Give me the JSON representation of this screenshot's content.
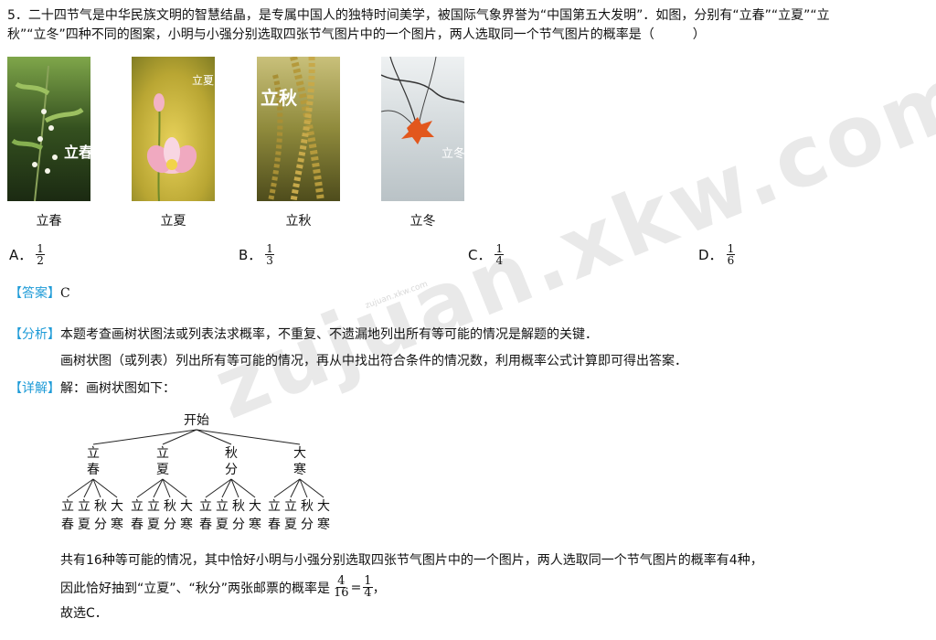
{
  "question": {
    "line1": "5．二十四节气是中华民族文明的智慧结晶，是专属中国人的独特时间美学，被国际气象界誉为“中国第五大发明”．如图，分别有“立春”“立夏”“立",
    "line2": "秋”“立冬”四种不同的图案，小明与小强分别选取四张节气图片中的一个图片，两人选取同一个节气图片的概率是（　　　）"
  },
  "images": [
    {
      "caption": "立春",
      "overlay": "立春"
    },
    {
      "caption": "立夏",
      "overlay": "立夏"
    },
    {
      "caption": "立秋",
      "overlay": "立秋"
    },
    {
      "caption": "立冬",
      "overlay": "立冬"
    }
  ],
  "options": [
    {
      "label": "A．",
      "num": "1",
      "den": "2"
    },
    {
      "label": "B．",
      "num": "1",
      "den": "3"
    },
    {
      "label": "C．",
      "num": "1",
      "den": "4"
    },
    {
      "label": "D．",
      "num": "1",
      "den": "6"
    }
  ],
  "answer": {
    "tag": "【答案】",
    "value": "C"
  },
  "analysis": {
    "tag": "【分析】",
    "line1": "本题考查画树状图法或列表法求概率，不重复、不遗漏地列出所有等可能的情况是解题的关键．",
    "line2": "画树状图（或列表）列出所有等可能的情况，再从中找出符合条件的情况数，利用概率公式计算即可得出答案．"
  },
  "detail": {
    "tag": "【详解】",
    "intro": "解：画树状图如下：",
    "tree": {
      "root": "开始",
      "level1": [
        [
          "立",
          "春"
        ],
        [
          "立",
          "夏"
        ],
        [
          "秋",
          "分"
        ],
        [
          "大",
          "寒"
        ]
      ],
      "leaves": [
        [
          "立",
          "春"
        ],
        [
          "立",
          "夏"
        ],
        [
          "秋",
          "分"
        ],
        [
          "大",
          "寒"
        ]
      ]
    },
    "line_total": "共有16种等可能的情况，其中恰好小明与小强分别选取四张节气图片中的一个图片，两人选取同一个节气图片的概率有4种，",
    "line_prob_prefix": "因此恰好抽到“立夏”、“秋分”两张邮票的概率是",
    "frac1": {
      "num": "4",
      "den": "16"
    },
    "eq": "=",
    "frac2": {
      "num": "1",
      "den": "4"
    },
    "line_prob_suffix": "，",
    "conclusion": "故选C．"
  },
  "watermark": {
    "big": "zujuan.xkw.com",
    "small": "zujuan.xkw.com"
  }
}
